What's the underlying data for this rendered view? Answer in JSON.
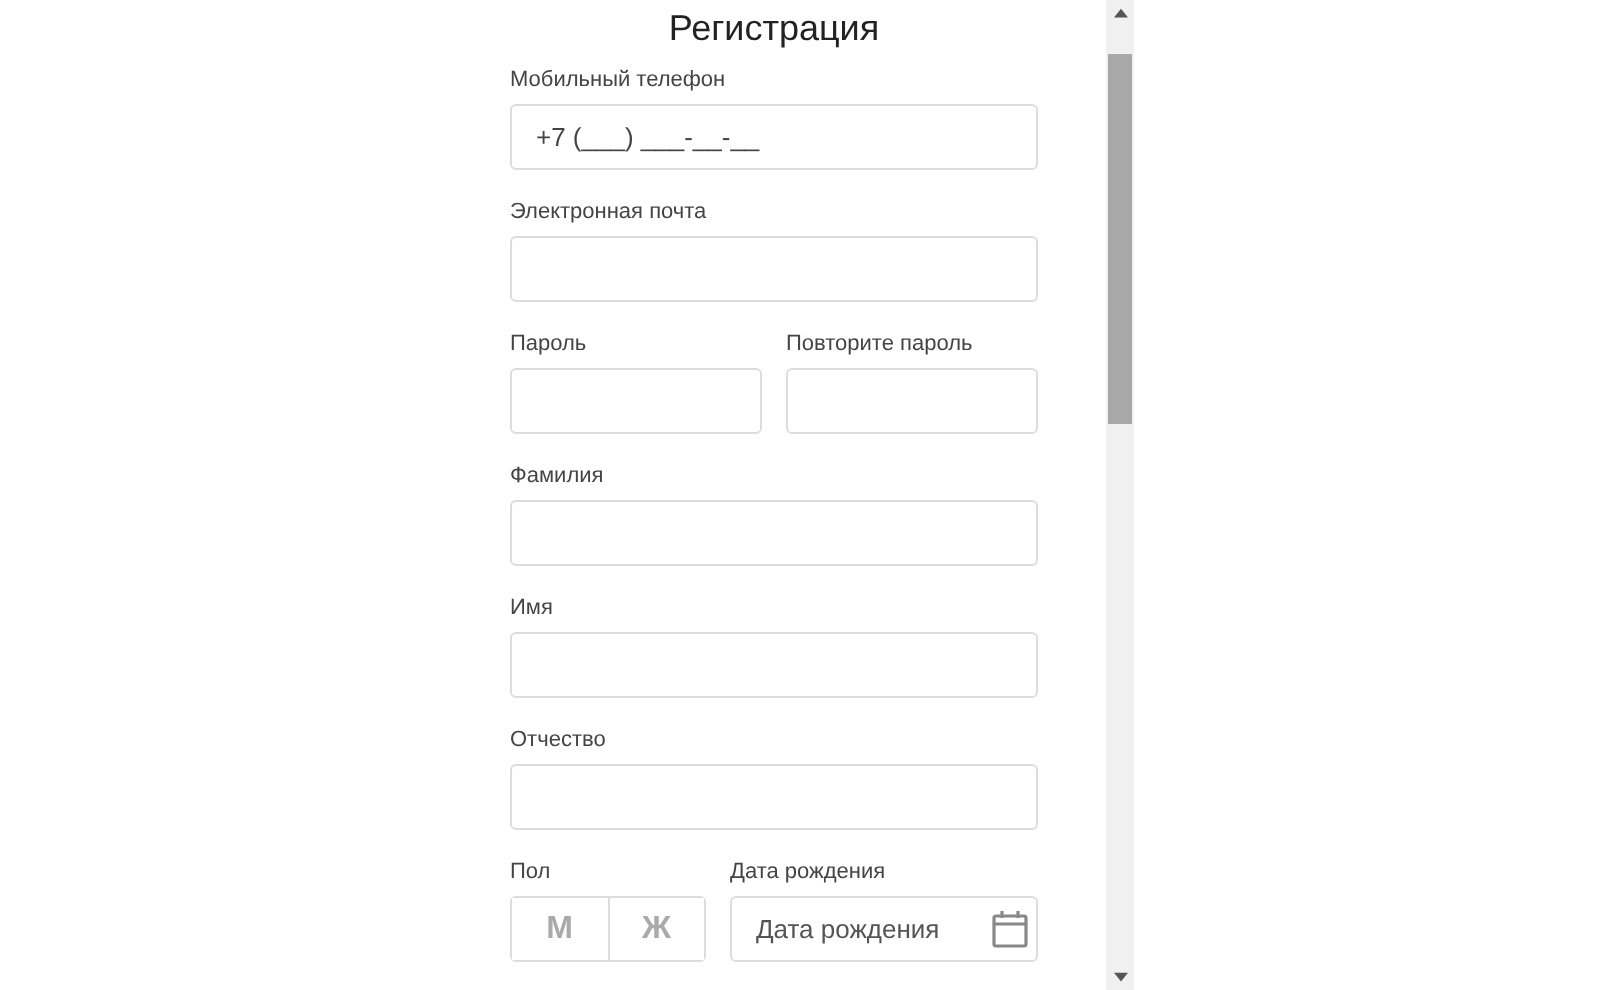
{
  "title": "Регистрация",
  "rows": [
    {
      "fields": [
        {
          "kind": "text",
          "label": "Мобильный телефон",
          "value": "+7 (___) ___-__-__"
        }
      ]
    },
    {
      "fields": [
        {
          "kind": "text",
          "label": "Электронная почта"
        }
      ]
    },
    {
      "fields": [
        {
          "kind": "text",
          "label": "Пароль"
        },
        {
          "kind": "text",
          "label": "Повторите пароль"
        }
      ]
    },
    {
      "fields": [
        {
          "kind": "text",
          "label": "Фамилия"
        }
      ]
    },
    {
      "fields": [
        {
          "kind": "text",
          "label": "Имя"
        }
      ]
    },
    {
      "fields": [
        {
          "kind": "text",
          "label": "Отчество"
        }
      ]
    },
    {
      "fields": [
        {
          "kind": "segmented",
          "label": "Пол",
          "options": [
            {
              "label": "М",
              "selected": false
            },
            {
              "label": "Ж",
              "selected": false
            }
          ]
        },
        {
          "kind": "date",
          "label": "Дата рождения",
          "placeholder": "Дата рождения"
        }
      ]
    }
  ]
}
